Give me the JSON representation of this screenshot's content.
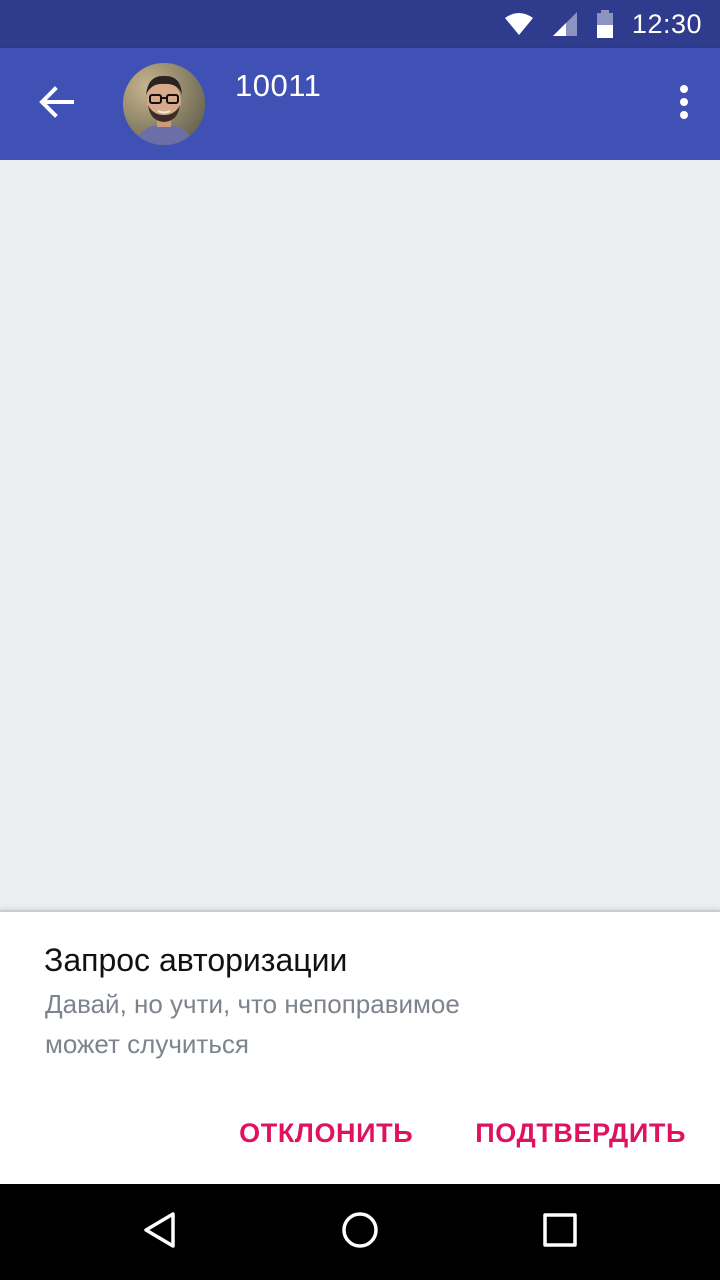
{
  "status_bar": {
    "time": "12:30",
    "icons": [
      "wifi-icon",
      "signal-icon",
      "battery-icon"
    ]
  },
  "toolbar": {
    "title": "10011",
    "back_icon": "arrow-back-icon",
    "menu_icon": "more-vert-icon",
    "background": "#3f51b5"
  },
  "auth_request": {
    "title": "Запрос авторизации",
    "message": "Давай, но учти, что непоправимое может случиться",
    "decline_label": "ОТКЛОНИТЬ",
    "confirm_label": "ПОДТВЕРДИТЬ",
    "accent": "#e0115f"
  },
  "nav_bar": {
    "icons": [
      "back-triangle-icon",
      "home-circle-icon",
      "recents-square-icon"
    ]
  }
}
